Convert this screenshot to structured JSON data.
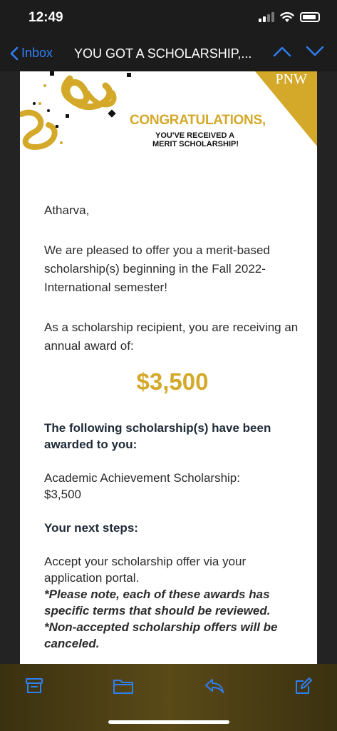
{
  "status": {
    "time": "12:49"
  },
  "nav": {
    "back_label": "Inbox",
    "subject": "YOU GOT A SCHOLARSHIP,..."
  },
  "banner": {
    "logo": "PNW",
    "congrats": "CONGRATULATIONS,",
    "line1": "YOU'VE RECEIVED A",
    "line2": "MERIT SCHOLARSHIP!"
  },
  "body": {
    "greeting": "Atharva,",
    "para1": "We are pleased to offer you a merit-based scholarship(s) beginning in the Fall 2022-International semester!",
    "para2": "As a scholarship recipient, you are receiving an annual award of:",
    "amount": "$3,500",
    "heading1": "The following scholarship(s) have been awarded to you:",
    "scholarship_name": "Academic Achievement Scholarship:",
    "scholarship_amount": "$3,500",
    "heading2": "Your next steps:",
    "step1": "Accept your scholarship offer via your application portal.",
    "note1": "*Please note, each of these awards has specific terms that should be reviewed.",
    "note2": "*Non-accepted scholarship offers will be canceled."
  },
  "colors": {
    "accent_gold": "#d4a92a",
    "ios_blue": "#2f7ff5"
  },
  "toolbar": [
    "archive-icon",
    "folder-icon",
    "reply-icon",
    "compose-icon"
  ]
}
